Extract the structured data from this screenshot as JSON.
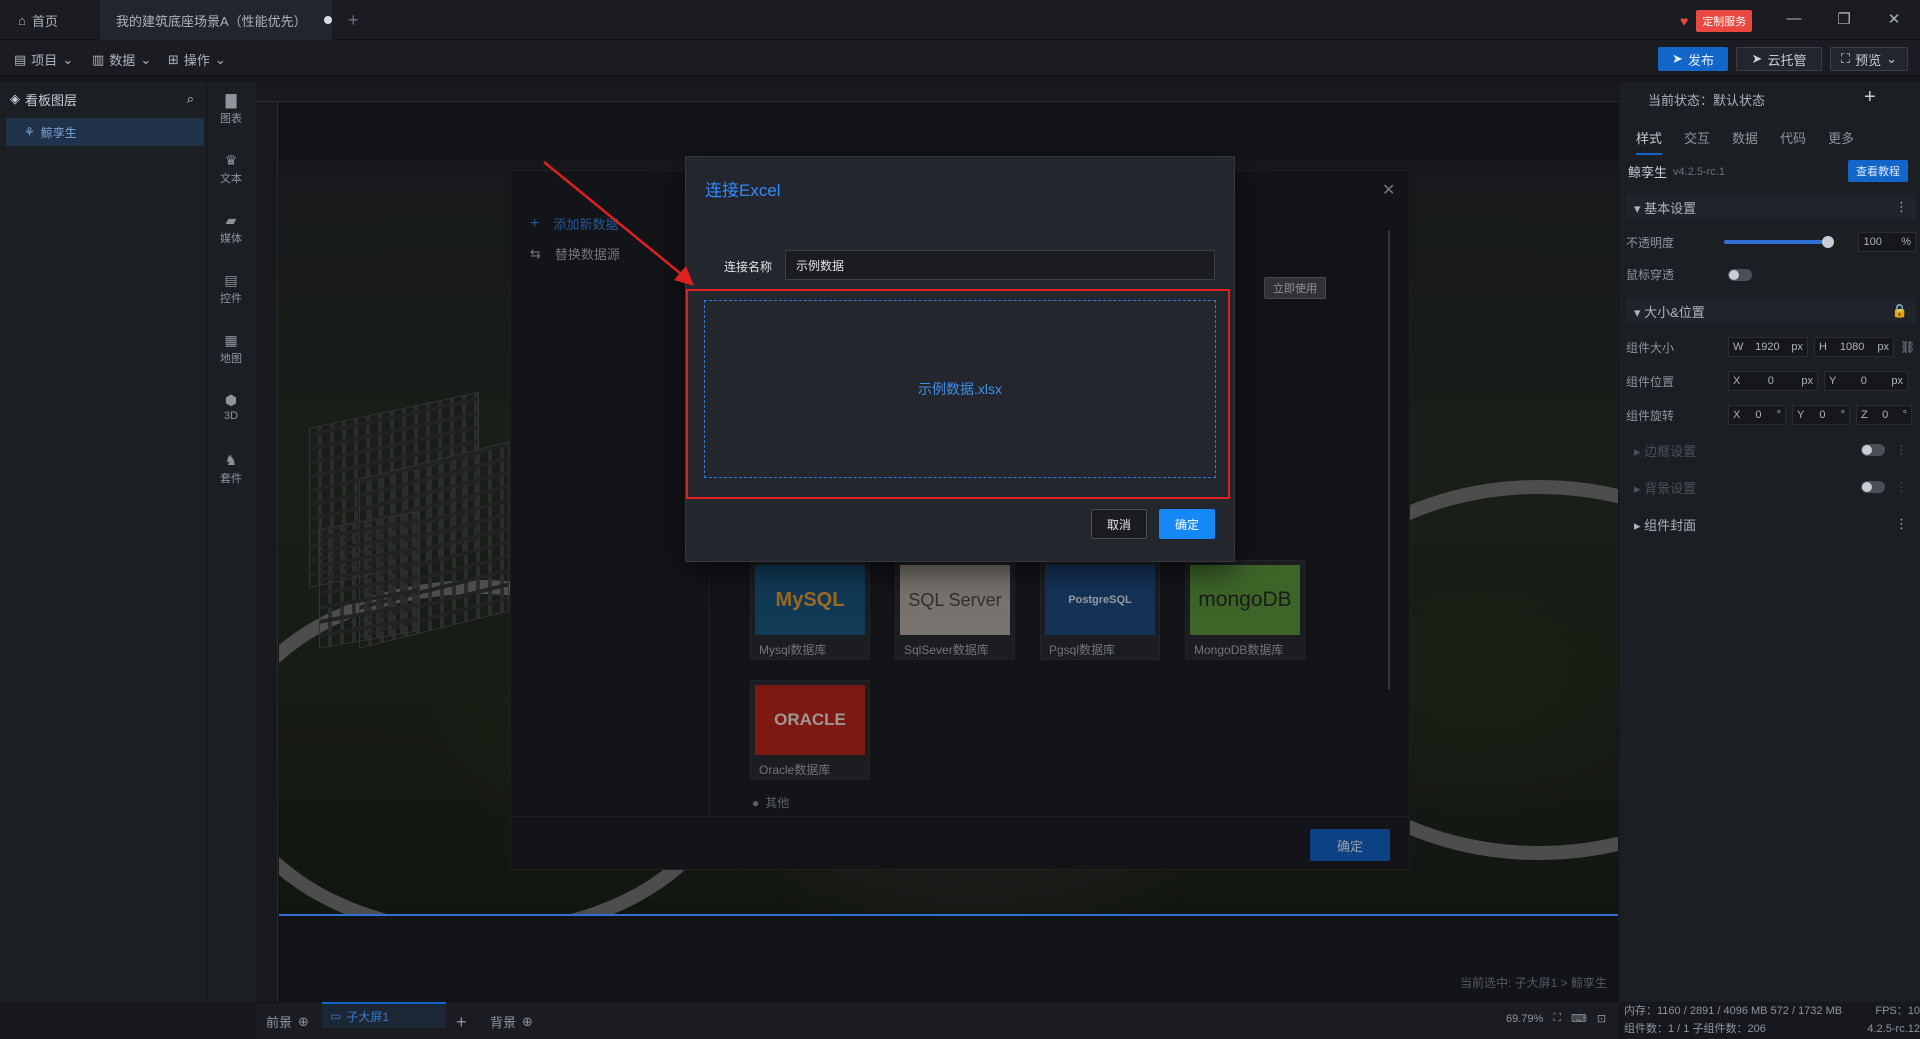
{
  "titlebar": {
    "home_label": "首页",
    "doc_tab_label": "我的建筑底座场景A（性能优先）",
    "service_label": "定制服务"
  },
  "menubar": {
    "project": "项目",
    "data": "数据",
    "operate": "操作",
    "publish": "发布",
    "cloud_host": "云托管",
    "preview": "预览"
  },
  "layers": {
    "title": "看板图层",
    "items": [
      {
        "label": "鲸孪生"
      }
    ]
  },
  "tools": [
    {
      "label": "图表",
      "icon": "chart-icon"
    },
    {
      "label": "文本",
      "icon": "text-icon"
    },
    {
      "label": "媒体",
      "icon": "media-icon"
    },
    {
      "label": "控件",
      "icon": "control-icon"
    },
    {
      "label": "地图",
      "icon": "map-icon"
    },
    {
      "label": "3D",
      "icon": "cube-icon"
    },
    {
      "label": "套件",
      "icon": "kit-icon"
    }
  ],
  "canvas": {
    "status_selected": "当前选中: 子大屏1 > 鲸孪生"
  },
  "bottombar": {
    "front": "前景",
    "tab": "子大屏1",
    "back": "背景",
    "zoom": "69.79%"
  },
  "right": {
    "state_label": "当前状态：默认状态",
    "tabs": [
      "样式",
      "交互",
      "数据",
      "代码",
      "更多"
    ],
    "component_name": "鲸孪生",
    "component_version": "v4.2.5-rc.1",
    "help_button": "查看教程",
    "basic_settings": "基本设置",
    "opacity_label": "不透明度",
    "opacity_value": "100",
    "opacity_unit": "%",
    "mouse_through_label": "鼠标穿透",
    "size_position": "大小&位置",
    "size_label": "组件大小",
    "w_label": "W",
    "w_value": "1920",
    "h_label": "H",
    "h_value": "1080",
    "px_unit": "px",
    "position_label": "组件位置",
    "x_label": "X",
    "x_value": "0",
    "y_label": "Y",
    "y_value": "0",
    "rotation_label": "组件旋转",
    "rx_value": "0",
    "ry_value": "0",
    "z_label": "Z",
    "rz_value": "0",
    "deg_unit": "°",
    "border_settings": "边框设置",
    "background_settings": "背景设置",
    "cover": "组件封面",
    "footer_memory": "内存：1160 / 2891 / 4096 MB  572 / 1732 MB",
    "footer_fps": "FPS：10",
    "footer_count": "组件数：1 / 1  子组件数：206",
    "footer_version": "4.2.5-rc.12"
  },
  "datasource_dialog": {
    "add_data": "添加新数据",
    "replace_source": "替换数据源",
    "use_now": "立即使用",
    "cards": [
      {
        "label": "Mysql数据库",
        "logo": "MySQL"
      },
      {
        "label": "SqlSever数据库",
        "logo": "SQL Server"
      },
      {
        "label": "Pgsql数据库",
        "logo": "PostgreSQL"
      },
      {
        "label": "MongoDB数据库",
        "logo": "mongoDB"
      },
      {
        "label": "Oracle数据库",
        "logo": "ORACLE"
      }
    ],
    "other": "其他",
    "confirm": "确定"
  },
  "excel_dialog": {
    "title": "连接Excel",
    "name_label": "连接名称",
    "name_value": "示例数据",
    "file_name": "示例数据.xlsx",
    "cancel": "取消",
    "confirm": "确定"
  },
  "colors": {
    "accent": "#1688f6",
    "highlight": "#e02020"
  }
}
